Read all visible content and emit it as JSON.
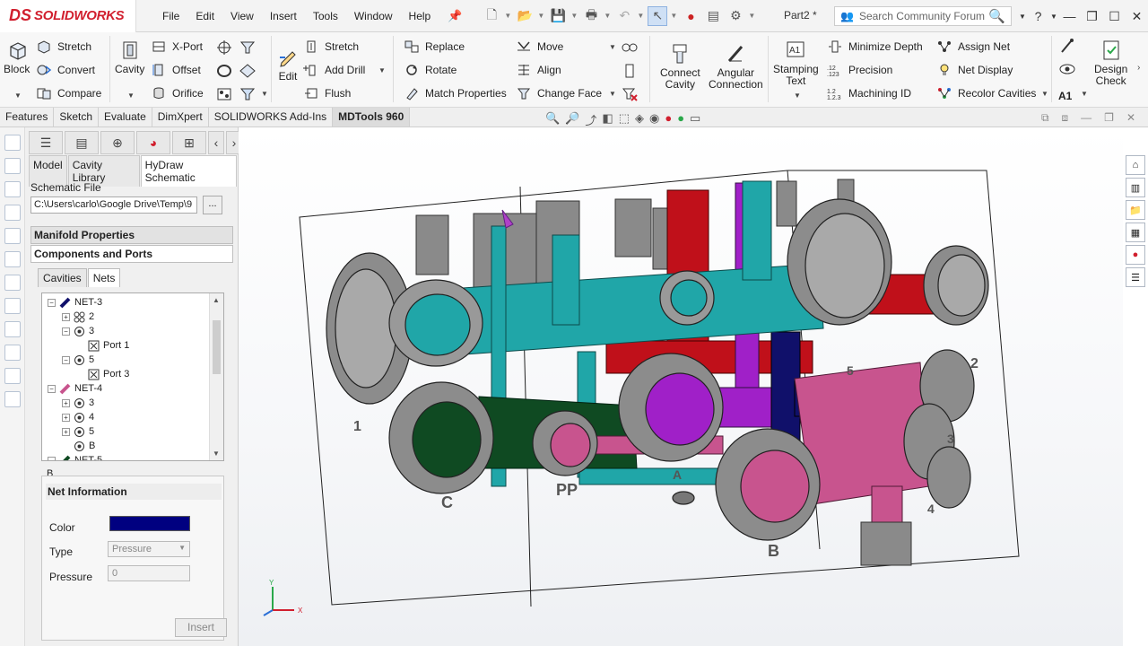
{
  "app": {
    "logo_ds": "DS",
    "logo_name": "SOLIDWORKS",
    "doc_title": "Part2 *"
  },
  "menu": [
    "File",
    "Edit",
    "View",
    "Insert",
    "Tools",
    "Window",
    "Help"
  ],
  "search": {
    "placeholder": "Search Community Forum"
  },
  "help": "?",
  "ribbon": {
    "block": "Block",
    "stretch": "Stretch",
    "convert": "Convert",
    "compare": "Compare",
    "cavity": "Cavity",
    "xport": "X-Port",
    "offset": "Offset",
    "orifice": "Orifice",
    "edit": "Edit",
    "stretch2": "Stretch",
    "add_drill": "Add Drill",
    "flush": "Flush",
    "replace": "Replace",
    "rotate": "Rotate",
    "match_properties": "Match Properties",
    "move": "Move",
    "align": "Align",
    "change_face": "Change Face",
    "connect_cavity": [
      "Connect",
      "Cavity"
    ],
    "angular_connection": [
      "Angular",
      "Connection"
    ],
    "stamping_text": [
      "Stamping",
      "Text"
    ],
    "minimize_depth": "Minimize Depth",
    "precision": "Precision",
    "machining_id": "Machining ID",
    "assign_net": "Assign Net",
    "net_display": "Net Display",
    "recolor_cavities": "Recolor Cavities",
    "design_check": [
      "Design",
      "Check"
    ],
    "a1": "A1"
  },
  "command_tabs": [
    "Features",
    "Sketch",
    "Evaluate",
    "DimXpert",
    "SOLIDWORKS Add-Ins",
    "MDTools 960"
  ],
  "active_command_tab": "MDTools 960",
  "panel": {
    "tabs": [
      "Model",
      "Cavity Library",
      "HyDraw Schematic"
    ],
    "active_tab": "HyDraw Schematic",
    "schematic_file_label": "Schematic File",
    "schematic_file_value": "C:\\Users\\carlo\\Google Drive\\Temp\\9",
    "browse": "...",
    "manifold_properties": "Manifold Properties",
    "components_and_ports": "Components and Ports",
    "inner_tabs": [
      "Cavities",
      "Nets"
    ],
    "active_inner_tab": "Nets",
    "tree": [
      {
        "level": 0,
        "exp": "-",
        "icon": "net-blue",
        "label": "NET-3"
      },
      {
        "level": 1,
        "exp": "+",
        "icon": "cavity-multi",
        "label": "2"
      },
      {
        "level": 1,
        "exp": "-",
        "icon": "cavity",
        "label": "3"
      },
      {
        "level": 2,
        "exp": "",
        "icon": "port",
        "label": "Port 1"
      },
      {
        "level": 1,
        "exp": "-",
        "icon": "cavity",
        "label": "5"
      },
      {
        "level": 2,
        "exp": "",
        "icon": "port",
        "label": "Port 3"
      },
      {
        "level": 0,
        "exp": "-",
        "icon": "net-pink",
        "label": "NET-4"
      },
      {
        "level": 1,
        "exp": "+",
        "icon": "cavity",
        "label": "3"
      },
      {
        "level": 1,
        "exp": "+",
        "icon": "cavity",
        "label": "4"
      },
      {
        "level": 1,
        "exp": "+",
        "icon": "cavity",
        "label": "5"
      },
      {
        "level": 1,
        "exp": "",
        "icon": "cavity",
        "label": "B"
      },
      {
        "level": 0,
        "exp": "-",
        "icon": "net-green",
        "label": "NET-5"
      }
    ],
    "b_label": "B",
    "net_information": "Net Information",
    "color_label": "Color",
    "color_value": "#000080",
    "type_label": "Type",
    "type_value": "Pressure",
    "pressure_label": "Pressure",
    "pressure_value": "0",
    "insert": "Insert"
  },
  "model_labels": [
    "1",
    "C",
    "PP",
    "A",
    "B",
    "2",
    "3",
    "4",
    "5"
  ],
  "axis": {
    "x": "X",
    "y": "Y"
  },
  "colors": {
    "teal": "#20a6a8",
    "red": "#c0101a",
    "purple": "#a020c8",
    "navy": "#10106a",
    "green": "#0f4a22",
    "pink": "#c8548e",
    "gray": "#8a8a8a"
  }
}
